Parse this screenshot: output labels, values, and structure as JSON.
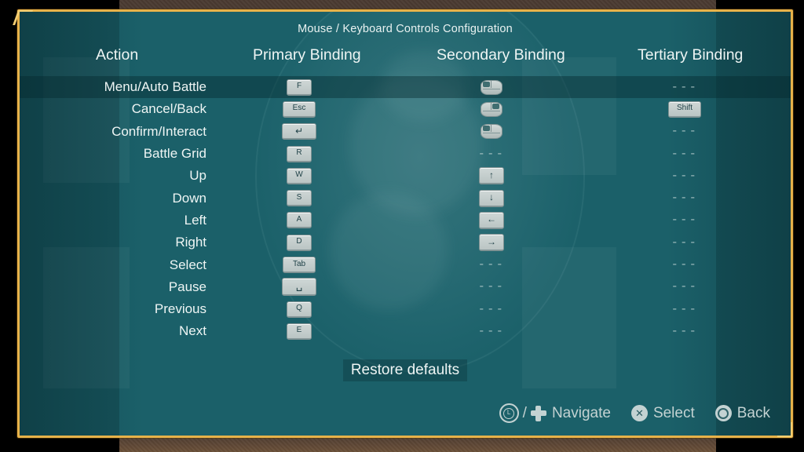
{
  "window": {
    "title": "Mouse / Keyboard Controls Configuration"
  },
  "columns": {
    "action": "Action",
    "primary": "Primary Binding",
    "secondary": "Secondary Binding",
    "tertiary": "Tertiary Binding"
  },
  "empty_binding": "---",
  "rows": [
    {
      "action": "Menu/Auto Battle",
      "selected": true,
      "primary": {
        "type": "key",
        "label": "F"
      },
      "secondary": {
        "type": "mouse",
        "button": "left"
      },
      "tertiary": {
        "type": "empty",
        "label": "---"
      }
    },
    {
      "action": "Cancel/Back",
      "selected": false,
      "primary": {
        "type": "key",
        "label": "Esc",
        "wide": true
      },
      "secondary": {
        "type": "mouse",
        "button": "right"
      },
      "tertiary": {
        "type": "key",
        "label": "Shift",
        "wide": true
      }
    },
    {
      "action": "Confirm/Interact",
      "selected": false,
      "primary": {
        "type": "key",
        "label": "↵",
        "style": "enter"
      },
      "secondary": {
        "type": "mouse",
        "button": "left"
      },
      "tertiary": {
        "type": "empty",
        "label": "---"
      }
    },
    {
      "action": "Battle Grid",
      "selected": false,
      "primary": {
        "type": "key",
        "label": "R"
      },
      "secondary": {
        "type": "empty",
        "label": "---"
      },
      "tertiary": {
        "type": "empty",
        "label": "---"
      }
    },
    {
      "action": "Up",
      "selected": false,
      "primary": {
        "type": "key",
        "label": "W"
      },
      "secondary": {
        "type": "key",
        "label": "↑",
        "style": "arrow"
      },
      "tertiary": {
        "type": "empty",
        "label": "---"
      }
    },
    {
      "action": "Down",
      "selected": false,
      "primary": {
        "type": "key",
        "label": "S"
      },
      "secondary": {
        "type": "key",
        "label": "↓",
        "style": "arrow"
      },
      "tertiary": {
        "type": "empty",
        "label": "---"
      }
    },
    {
      "action": "Left",
      "selected": false,
      "primary": {
        "type": "key",
        "label": "A"
      },
      "secondary": {
        "type": "key",
        "label": "←",
        "style": "arrow"
      },
      "tertiary": {
        "type": "empty",
        "label": "---"
      }
    },
    {
      "action": "Right",
      "selected": false,
      "primary": {
        "type": "key",
        "label": "D"
      },
      "secondary": {
        "type": "key",
        "label": "→",
        "style": "arrow"
      },
      "tertiary": {
        "type": "empty",
        "label": "---"
      }
    },
    {
      "action": "Select",
      "selected": false,
      "primary": {
        "type": "key",
        "label": "Tab",
        "wide": true
      },
      "secondary": {
        "type": "empty",
        "label": "---"
      },
      "tertiary": {
        "type": "empty",
        "label": "---"
      }
    },
    {
      "action": "Pause",
      "selected": false,
      "primary": {
        "type": "key",
        "label": "␣",
        "style": "space"
      },
      "secondary": {
        "type": "empty",
        "label": "---"
      },
      "tertiary": {
        "type": "empty",
        "label": "---"
      }
    },
    {
      "action": "Previous",
      "selected": false,
      "primary": {
        "type": "key",
        "label": "Q"
      },
      "secondary": {
        "type": "empty",
        "label": "---"
      },
      "tertiary": {
        "type": "empty",
        "label": "---"
      }
    },
    {
      "action": "Next",
      "selected": false,
      "primary": {
        "type": "key",
        "label": "E"
      },
      "secondary": {
        "type": "empty",
        "label": "---"
      },
      "tertiary": {
        "type": "empty",
        "label": "---"
      }
    }
  ],
  "restore_defaults": "Restore defaults",
  "hints": [
    {
      "icons": [
        "left-stick",
        "dpad"
      ],
      "separator": "/",
      "label": "Navigate"
    },
    {
      "icons": [
        "cross-button"
      ],
      "label": "Select"
    },
    {
      "icons": [
        "circle-button"
      ],
      "label": "Back"
    }
  ],
  "glyphs": {
    "left_stick": "L",
    "cross": "✕",
    "slash": "/"
  },
  "colors": {
    "frame_gold": "#e7b24a",
    "panel_teal": "#155058",
    "panel_teal_light": "#1b6069",
    "selected_row": "#0a2f36",
    "text": "#eef5f4",
    "keycap": "#cfd7d6",
    "hint_text": "#c3d2d2",
    "backdrop_brown": "#4a3a31"
  }
}
